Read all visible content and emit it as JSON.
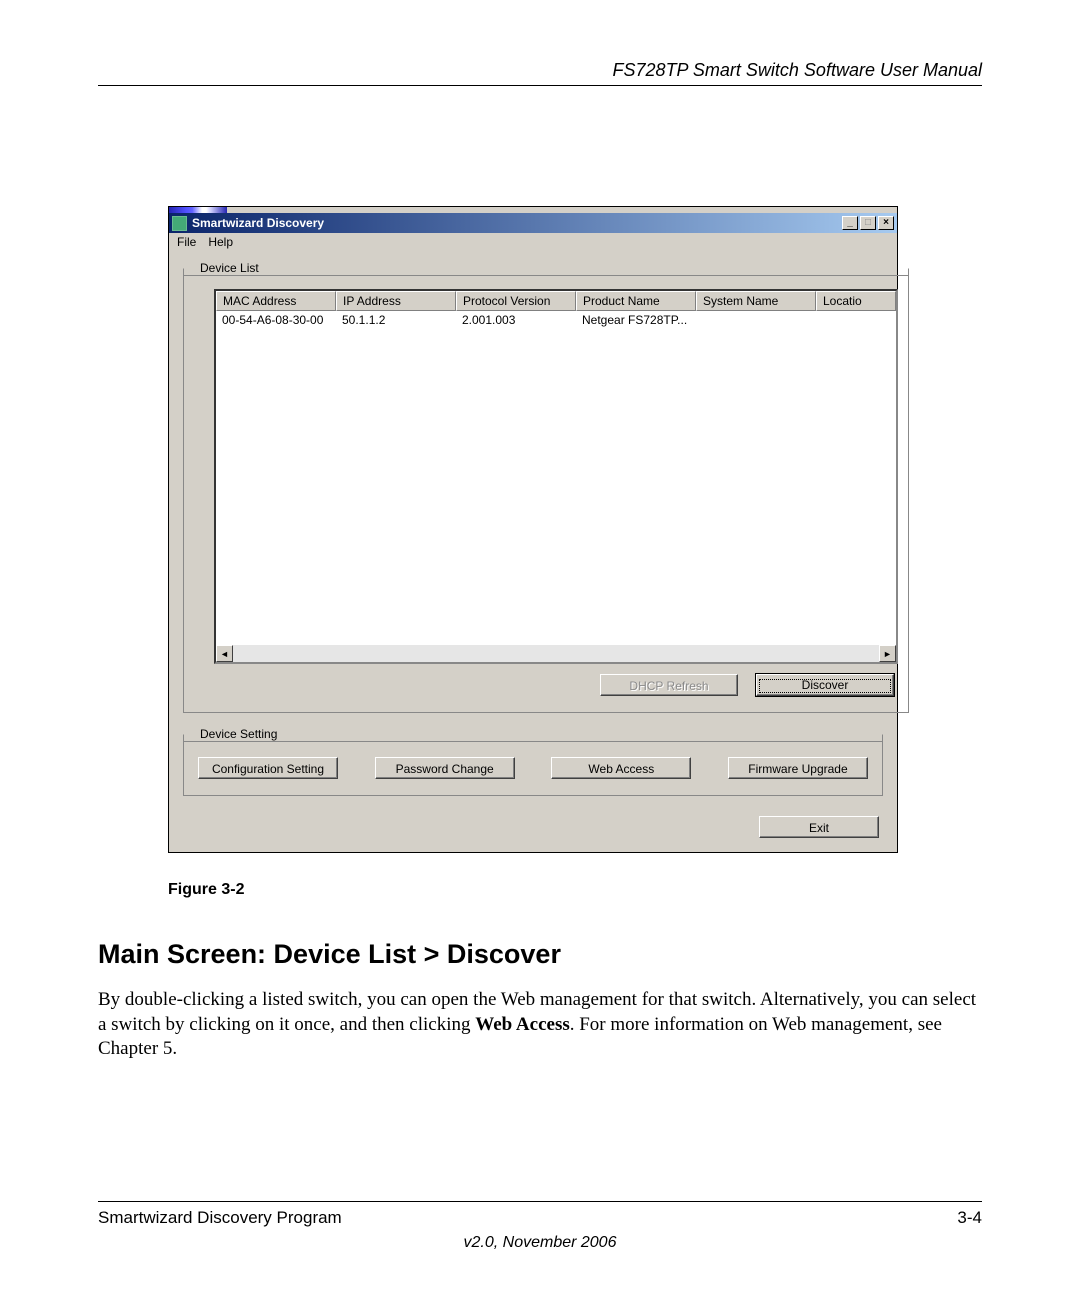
{
  "doc": {
    "header_title": "FS728TP Smart Switch Software User Manual",
    "figure_caption": "Figure 3-2",
    "section_heading": "Main Screen: Device List > Discover",
    "body_pre": "By double-clicking a listed switch, you can open the Web management for that switch. Alternatively, you can select a switch by clicking on it once, and then clicking ",
    "body_bold": "Web Access",
    "body_post": ". For more information on Web management, see Chapter 5.",
    "footer_left": "Smartwizard Discovery Program",
    "footer_right": "3-4",
    "footer_version": "v2.0, November 2006"
  },
  "win": {
    "title": "Smartwizard Discovery",
    "menu": {
      "file": "File",
      "help": "Help"
    },
    "group_device_list": "Device List",
    "group_device_setting": "Device Setting",
    "columns": {
      "mac": "MAC Address",
      "ip": "IP Address",
      "proto": "Protocol Version",
      "product": "Product Name",
      "sysname": "System Name",
      "location": "Locatio"
    },
    "rows": [
      {
        "mac": "00-54-A6-08-30-00",
        "ip": "50.1.1.2",
        "proto": "2.001.003",
        "product": "Netgear FS728TP...",
        "sysname": "",
        "location": ""
      }
    ],
    "buttons": {
      "dhcp_refresh": "DHCP Refresh",
      "discover": "Discover",
      "config_setting": "Configuration Setting",
      "password_change": "Password Change",
      "web_access": "Web Access",
      "firmware_upgrade": "Firmware Upgrade",
      "exit": "Exit"
    },
    "window_controls": {
      "minimize": "_",
      "maximize": "□",
      "close": "×"
    }
  }
}
